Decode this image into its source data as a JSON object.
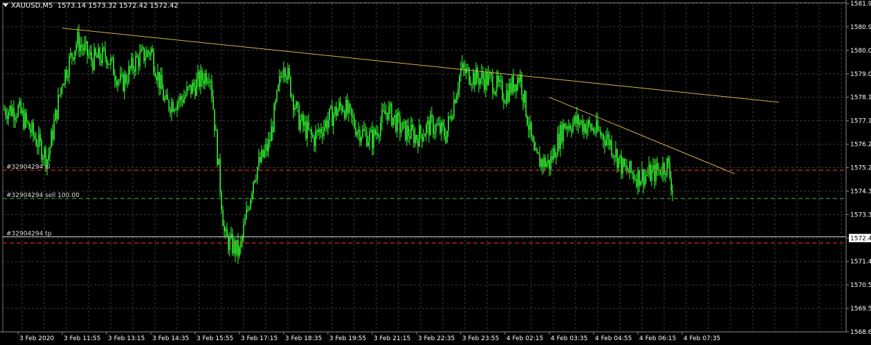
{
  "header": {
    "symbol_tf": "XAUUSD,M5",
    "ohlc": [
      "1573.14",
      "1573.32",
      "1572.42",
      "1572.42"
    ]
  },
  "colors": {
    "background": "#000000",
    "grid": "#3a3a3a",
    "candle": "#33ff33",
    "trendline": "#d9b24c",
    "sl_line": "#ff3333",
    "entry_line": "#33cc33",
    "bid_line": "#c8c8c8",
    "text": "#ffffff"
  },
  "chart_data": {
    "type": "candlestick",
    "ylim": [
      1568.6,
      1581.9
    ],
    "y_ticks": [
      "1581.90",
      "1580.95",
      "1580.00",
      "1579.05",
      "1578.10",
      "1577.15",
      "1576.20",
      "1575.25",
      "1574.30",
      "1573.35",
      "1572.42",
      "1571.45",
      "1570.50",
      "1569.55",
      "1568.60"
    ],
    "x_ticks": [
      "3 Feb 2020",
      "3 Feb 11:55",
      "3 Feb 13:15",
      "3 Feb 14:35",
      "3 Feb 15:55",
      "3 Feb 17:15",
      "3 Feb 18:35",
      "3 Feb 19:55",
      "3 Feb 21:15",
      "3 Feb 22:35",
      "3 Feb 23:55",
      "4 Feb 02:15",
      "4 Feb 03:35",
      "4 Feb 04:55",
      "4 Feb 06:15",
      "4 Feb 07:35"
    ],
    "grid": true,
    "current_price": "1572.42",
    "close_path": [
      [
        "3 Feb 2020",
        1577.6
      ],
      [
        "3 Feb 2020",
        1576.6
      ],
      [
        "3 Feb 2020",
        1575.6
      ],
      [
        "3 Feb 11:55",
        1578.8
      ],
      [
        "3 Feb 11:55",
        1580.4
      ],
      [
        "3 Feb 11:55",
        1579.6
      ],
      [
        "3 Feb 13:15",
        1579.8
      ],
      [
        "3 Feb 13:15",
        1578.6
      ],
      [
        "3 Feb 13:15",
        1579.6
      ],
      [
        "3 Feb 14:35",
        1580.0
      ],
      [
        "3 Feb 14:35",
        1577.8
      ],
      [
        "3 Feb 14:35",
        1578.0
      ],
      [
        "3 Feb 15:55",
        1578.6
      ],
      [
        "3 Feb 15:55",
        1579.2
      ],
      [
        "3 Feb 15:55",
        1572.4
      ],
      [
        "3 Feb 17:15",
        1571.8
      ],
      [
        "3 Feb 17:15",
        1575.0
      ],
      [
        "3 Feb 17:15",
        1576.2
      ],
      [
        "3 Feb 18:35",
        1579.6
      ],
      [
        "3 Feb 18:35",
        1577.2
      ],
      [
        "3 Feb 18:35",
        1576.4
      ],
      [
        "3 Feb 19:55",
        1577.2
      ],
      [
        "3 Feb 19:55",
        1577.8
      ],
      [
        "3 Feb 19:55",
        1576.8
      ],
      [
        "3 Feb 21:15",
        1576.4
      ],
      [
        "3 Feb 21:15",
        1577.6
      ],
      [
        "3 Feb 21:15",
        1576.8
      ],
      [
        "3 Feb 22:35",
        1576.5
      ],
      [
        "3 Feb 22:35",
        1577.0
      ],
      [
        "3 Feb 22:35",
        1576.6
      ],
      [
        "3 Feb 23:55",
        1579.2
      ],
      [
        "3 Feb 23:55",
        1578.9
      ],
      [
        "3 Feb 23:55",
        1578.8
      ],
      [
        "4 Feb 02:15",
        1578.2
      ],
      [
        "4 Feb 02:15",
        1579.0
      ],
      [
        "4 Feb 02:15",
        1575.6
      ],
      [
        "4 Feb 03:35",
        1575.4
      ],
      [
        "4 Feb 03:35",
        1577.0
      ],
      [
        "4 Feb 03:35",
        1577.1
      ],
      [
        "4 Feb 04:55",
        1576.8
      ],
      [
        "4 Feb 04:55",
        1576.4
      ],
      [
        "4 Feb 04:55",
        1575.2
      ],
      [
        "4 Feb 06:15",
        1574.9
      ],
      [
        "4 Feb 06:15",
        1575.0
      ],
      [
        "4 Feb 06:15",
        1575.4
      ],
      [
        "4 Feb 07:35",
        1572.42
      ]
    ],
    "trendlines": [
      {
        "from": [
          "3 Feb 11:55",
          1580.9
        ],
        "to": [
          "4 Feb 07:35+",
          1577.9
        ]
      },
      {
        "from": [
          "4 Feb 03:35",
          1578.1
        ],
        "to": [
          "4 Feb 06:15+",
          1575.0
        ]
      }
    ],
    "horizontal_lines": [
      {
        "label": "#32904294 sl",
        "price": 1575.15,
        "style": "sl"
      },
      {
        "label": "#32904294 sell 100.00",
        "price": 1574.0,
        "style": "entry"
      },
      {
        "label": "#32904294 tp",
        "price": 1572.45,
        "style": "tp"
      },
      {
        "label": "",
        "price": 1572.2,
        "style": "sl"
      }
    ]
  }
}
